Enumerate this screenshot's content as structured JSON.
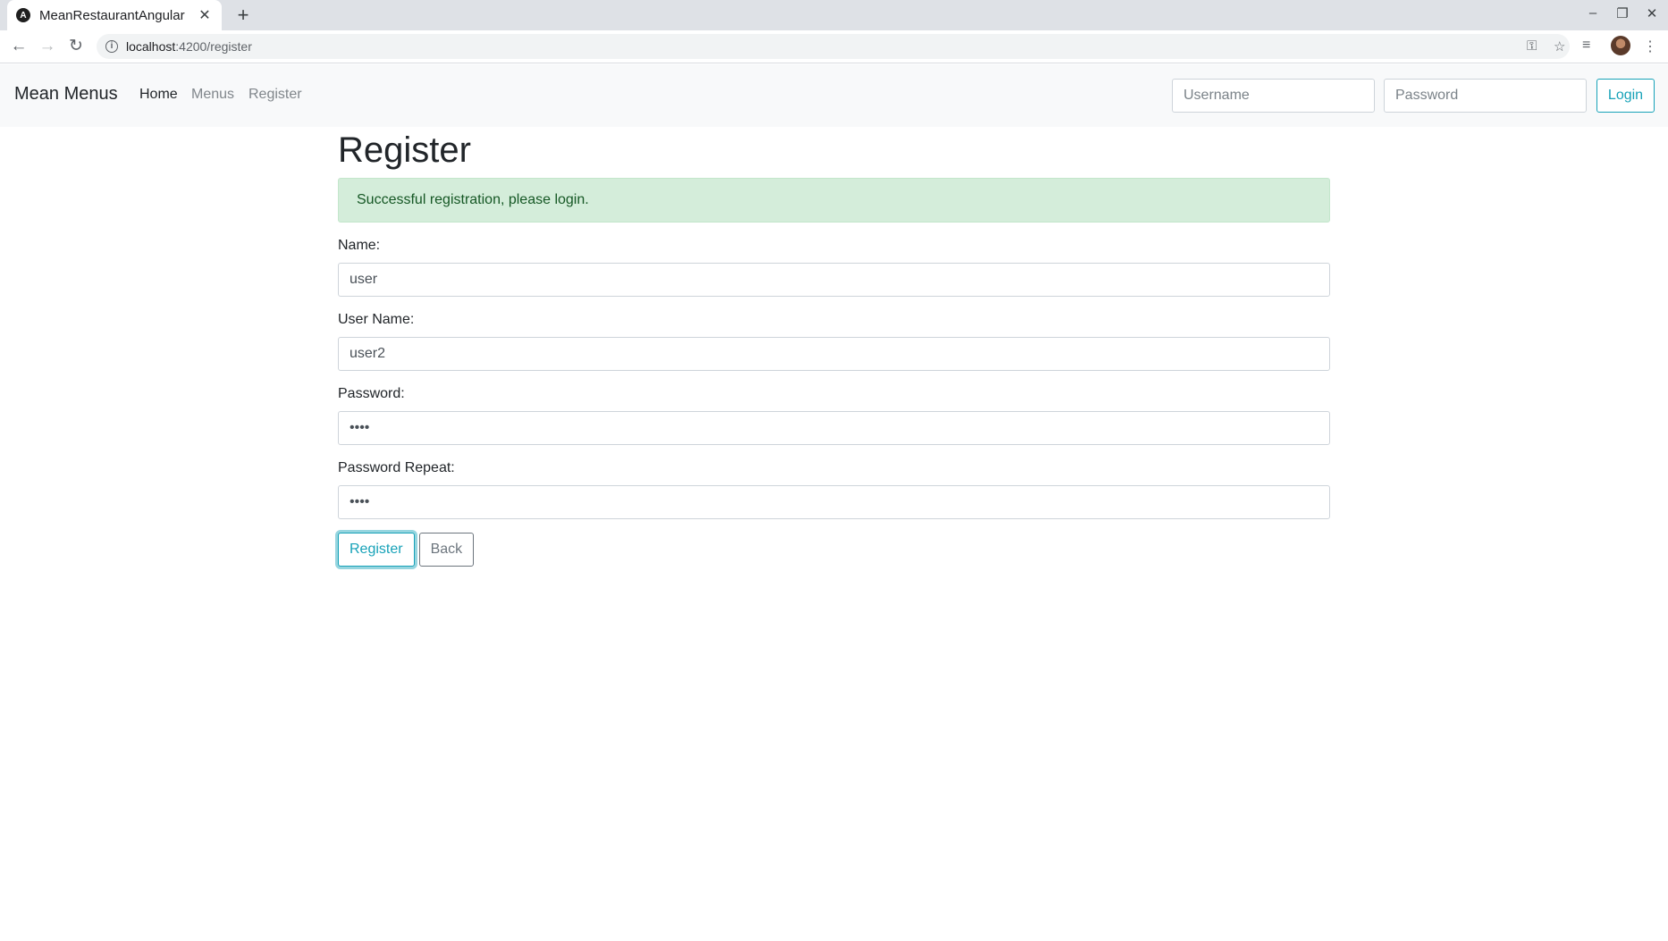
{
  "browser": {
    "tab_title": "MeanRestaurantAngular",
    "favicon_letter": "A",
    "url_host": "localhost",
    "url_path": ":4200/register"
  },
  "navbar": {
    "brand": "Mean Menus",
    "links": [
      {
        "label": "Home",
        "active": true
      },
      {
        "label": "Menus",
        "active": false
      },
      {
        "label": "Register",
        "active": false
      }
    ],
    "username_placeholder": "Username",
    "password_placeholder": "Password",
    "login_label": "Login"
  },
  "page": {
    "title": "Register",
    "alert": "Successful registration, please login.",
    "fields": {
      "name": {
        "label": "Name:",
        "value": "user"
      },
      "username": {
        "label": "User Name:",
        "value": "user2"
      },
      "password": {
        "label": "Password:",
        "value": "user"
      },
      "password_repeat": {
        "label": "Password Repeat:",
        "value": "user"
      }
    },
    "register_label": "Register",
    "back_label": "Back"
  },
  "colors": {
    "accent": "#17a2b8",
    "success_bg": "#d4edda",
    "success_text": "#155724",
    "secondary": "#6c757d"
  }
}
